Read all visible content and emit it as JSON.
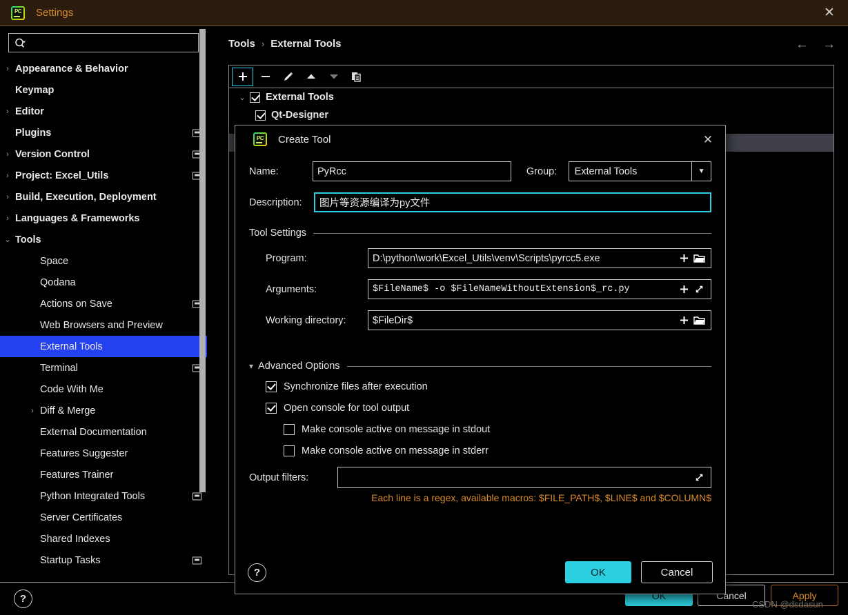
{
  "window": {
    "title": "Settings",
    "app_icon": "pycharm-icon",
    "close_icon": "close-icon"
  },
  "search": {
    "value": "",
    "placeholder": "",
    "icon": "search-icon"
  },
  "sidebar": {
    "items": [
      {
        "label": "Appearance & Behavior",
        "level": 0,
        "twisty": "collapsed",
        "badge": false,
        "selected": false
      },
      {
        "label": "Keymap",
        "level": 0,
        "twisty": "none",
        "badge": false,
        "selected": false
      },
      {
        "label": "Editor",
        "level": 0,
        "twisty": "collapsed",
        "badge": false,
        "selected": false
      },
      {
        "label": "Plugins",
        "level": 0,
        "twisty": "none",
        "badge": true,
        "selected": false
      },
      {
        "label": "Version Control",
        "level": 0,
        "twisty": "collapsed",
        "badge": true,
        "selected": false
      },
      {
        "label": "Project: Excel_Utils",
        "level": 0,
        "twisty": "collapsed",
        "badge": true,
        "selected": false
      },
      {
        "label": "Build, Execution, Deployment",
        "level": 0,
        "twisty": "collapsed",
        "badge": false,
        "selected": false
      },
      {
        "label": "Languages & Frameworks",
        "level": 0,
        "twisty": "collapsed",
        "badge": false,
        "selected": false
      },
      {
        "label": "Tools",
        "level": 0,
        "twisty": "expanded",
        "badge": false,
        "selected": false
      },
      {
        "label": "Space",
        "level": 1,
        "twisty": "none",
        "badge": false,
        "selected": false
      },
      {
        "label": "Qodana",
        "level": 1,
        "twisty": "none",
        "badge": false,
        "selected": false
      },
      {
        "label": "Actions on Save",
        "level": 1,
        "twisty": "none",
        "badge": true,
        "selected": false
      },
      {
        "label": "Web Browsers and Preview",
        "level": 1,
        "twisty": "none",
        "badge": false,
        "selected": false
      },
      {
        "label": "External Tools",
        "level": 1,
        "twisty": "none",
        "badge": false,
        "selected": true
      },
      {
        "label": "Terminal",
        "level": 1,
        "twisty": "none",
        "badge": true,
        "selected": false
      },
      {
        "label": "Code With Me",
        "level": 1,
        "twisty": "none",
        "badge": false,
        "selected": false
      },
      {
        "label": "Diff & Merge",
        "level": 1,
        "twisty": "collapsed",
        "badge": false,
        "selected": false
      },
      {
        "label": "External Documentation",
        "level": 1,
        "twisty": "none",
        "badge": false,
        "selected": false
      },
      {
        "label": "Features Suggester",
        "level": 1,
        "twisty": "none",
        "badge": false,
        "selected": false
      },
      {
        "label": "Features Trainer",
        "level": 1,
        "twisty": "none",
        "badge": false,
        "selected": false
      },
      {
        "label": "Python Integrated Tools",
        "level": 1,
        "twisty": "none",
        "badge": true,
        "selected": false
      },
      {
        "label": "Server Certificates",
        "level": 1,
        "twisty": "none",
        "badge": false,
        "selected": false
      },
      {
        "label": "Shared Indexes",
        "level": 1,
        "twisty": "none",
        "badge": false,
        "selected": false
      },
      {
        "label": "Startup Tasks",
        "level": 1,
        "twisty": "none",
        "badge": true,
        "selected": false
      }
    ]
  },
  "main": {
    "breadcrumb": {
      "parent": "Tools",
      "separator": "›",
      "current": "External Tools"
    },
    "nav": {
      "back_icon": "arrow-left-icon",
      "forward_icon": "arrow-right-icon"
    },
    "toolbar": [
      {
        "name": "add",
        "icon": "plus-icon",
        "focused": true
      },
      {
        "name": "remove",
        "icon": "minus-icon",
        "focused": false
      },
      {
        "name": "edit",
        "icon": "pencil-icon",
        "focused": false
      },
      {
        "name": "move-up",
        "icon": "arrow-up-icon",
        "focused": false
      },
      {
        "name": "move-down",
        "icon": "arrow-down-icon",
        "focused": false
      },
      {
        "name": "copy",
        "icon": "copy-icon",
        "focused": false
      }
    ],
    "tools_tree": [
      {
        "label": "External Tools",
        "checked": true,
        "twisty": "expanded",
        "sub": false,
        "highlight": false
      },
      {
        "label": "Qt-Designer",
        "checked": true,
        "twisty": "none",
        "sub": true,
        "highlight": false
      }
    ]
  },
  "dialog": {
    "title": "Create Tool",
    "app_icon": "pycharm-icon",
    "close_icon": "close-icon",
    "name_label": "Name:",
    "name_value": "PyRcc",
    "group_label": "Group:",
    "group_value": "External Tools",
    "description_label": "Description:",
    "description_value": "图片等资源编译为py文件",
    "tool_settings_title": "Tool Settings",
    "program_label": "Program:",
    "program_value": "D:\\python\\work\\Excel_Utils\\venv\\Scripts\\pyrcc5.exe",
    "arguments_label": "Arguments:",
    "arguments_value": "$FileName$ -o $FileNameWithoutExtension$_rc.py",
    "working_dir_label": "Working directory:",
    "working_dir_value": "$FileDir$",
    "advanced_options_title": "Advanced Options",
    "checkboxes": [
      {
        "label": "Synchronize files after execution",
        "checked": true,
        "indent": false
      },
      {
        "label": "Open console for tool output",
        "checked": true,
        "indent": false
      },
      {
        "label": "Make console active on message in stdout",
        "checked": false,
        "indent": true
      },
      {
        "label": "Make console active on message in stderr",
        "checked": false,
        "indent": true
      }
    ],
    "output_filters_label": "Output filters:",
    "output_filters_value": "",
    "hint": "Each line is a regex, available macros: $FILE_PATH$, $LINE$ and $COLUMN$",
    "help_label": "?",
    "ok_label": "OK",
    "cancel_label": "Cancel"
  },
  "footer": {
    "help_label": "?",
    "ok_label": "OK",
    "cancel_label": "Cancel",
    "apply_label": "Apply",
    "watermark": "CSDN @dsdasun"
  },
  "colors": {
    "titlebar_bg": "#2b1c0d",
    "title_text": "#d98a2b",
    "selection": "#2341f0",
    "accent_cyan": "#2ad0e0",
    "hint_orange": "#d98a2b",
    "row_highlight": "#3f4049"
  }
}
